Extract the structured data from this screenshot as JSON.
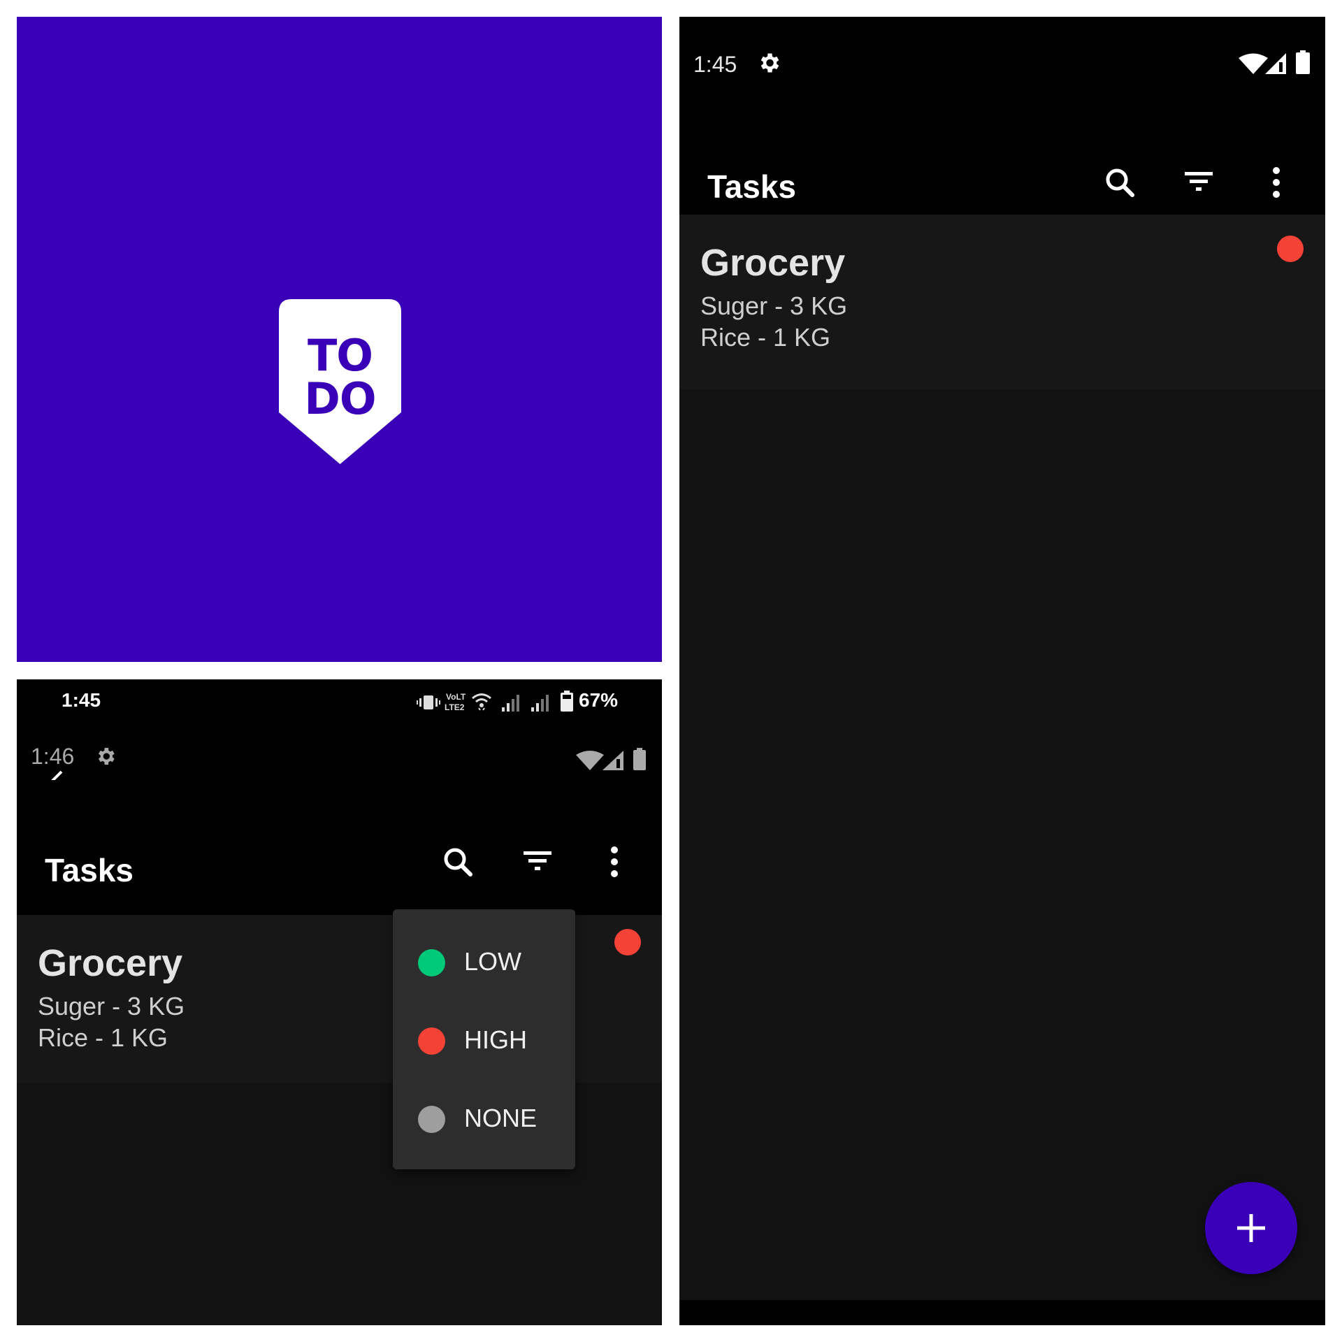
{
  "splash": {
    "logo_line1": "TO",
    "logo_line2": "DO",
    "brand_color": "#3a00b8"
  },
  "menu_screen": {
    "device_status": {
      "time": "1:45",
      "icons": [
        "vibrate-icon",
        "volte-lte-icon",
        "wifi-icon",
        "signal-sim1-icon",
        "signal-sim2-icon",
        "battery-icon"
      ],
      "battery_percent": "67%"
    },
    "emulator_status": {
      "time": "1:46",
      "icons": [
        "settings-icon",
        "wifi-icon",
        "signal-icon",
        "battery-icon"
      ]
    },
    "appbar": {
      "title": "Tasks",
      "actions": [
        "search-icon",
        "filter-icon",
        "more-vert-icon"
      ]
    },
    "task": {
      "title": "Grocery",
      "lines": [
        "Suger - 3 KG",
        "Rice - 1 KG"
      ],
      "priority": "HIGH",
      "priority_color": "#f44336"
    },
    "priority_menu": [
      {
        "label": "LOW",
        "color": "#00c97a"
      },
      {
        "label": "HIGH",
        "color": "#f44336"
      },
      {
        "label": "NONE",
        "color": "#9e9e9e"
      }
    ]
  },
  "list_screen": {
    "status": {
      "time": "1:45",
      "icons": [
        "settings-icon",
        "wifi-icon",
        "signal-icon",
        "battery-icon"
      ]
    },
    "appbar": {
      "title": "Tasks",
      "actions": [
        "search-icon",
        "filter-icon",
        "more-vert-icon"
      ]
    },
    "tasks": [
      {
        "title": "Grocery",
        "lines": [
          "Suger - 3 KG",
          "Rice - 1 KG"
        ],
        "priority": "HIGH",
        "priority_color": "#f44336"
      }
    ],
    "fab": {
      "icon": "add-icon",
      "color": "#3a00b8"
    }
  }
}
